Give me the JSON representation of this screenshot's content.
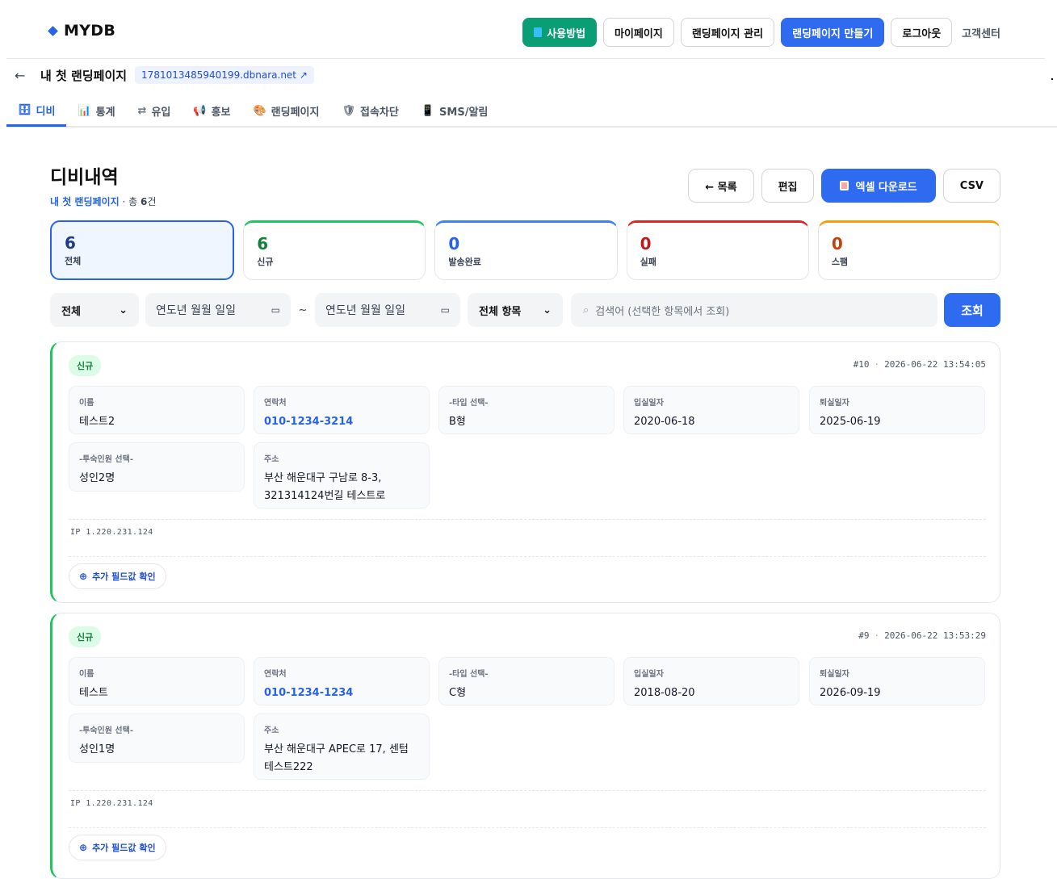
{
  "brand": "MYDB",
  "nav": {
    "guide": "사용방법",
    "mypage": "마이페이지",
    "manage": "랜딩페이지 관리",
    "create": "랜딩페이지 만들기",
    "logout": "로그아웃",
    "support": "고객센터"
  },
  "page": {
    "title": "내 첫 랜딩페이지",
    "url": "1781013485940199.dbnara.net"
  },
  "tabs": [
    {
      "label": "디비",
      "icon": "database-icon",
      "glyph": "🗄"
    },
    {
      "label": "통계",
      "icon": "chart-icon",
      "glyph": "📊"
    },
    {
      "label": "유입",
      "icon": "flow-icon",
      "glyph": "⇄"
    },
    {
      "label": "홍보",
      "icon": "megaphone-icon",
      "glyph": "📢"
    },
    {
      "label": "랜딩페이지",
      "icon": "palette-icon",
      "glyph": "🎨"
    },
    {
      "label": "접속차단",
      "icon": "shield-icon",
      "glyph": "🛡"
    },
    {
      "label": "SMS/알림",
      "icon": "phone-icon",
      "glyph": "📱"
    }
  ],
  "heading": {
    "title": "디비내역",
    "landing": "내 첫 랜딩페이지",
    "total_prefix": " · 총 ",
    "total": "6",
    "total_suffix": "건"
  },
  "actions": {
    "list": "← 목록",
    "edit": "편집",
    "excel": "엑셀 다운로드",
    "csv": "CSV"
  },
  "stats": [
    {
      "n": "6",
      "label": "전체",
      "color": "#1e3a8a"
    },
    {
      "n": "6",
      "label": "신규",
      "color": "#15803d"
    },
    {
      "n": "0",
      "label": "발송완료",
      "color": "#2563eb"
    },
    {
      "n": "0",
      "label": "실패",
      "color": "#b91c1c"
    },
    {
      "n": "0",
      "label": "스팸",
      "color": "#c2410c"
    }
  ],
  "stat_colors": [
    "#2563eb",
    "#22c55e",
    "#3b82f6",
    "#dc2626",
    "#f59e0b"
  ],
  "filters": {
    "status": "전체",
    "date_from": "연도년 월월 일일",
    "tilde": "~",
    "date_to": "연도년 월월 일일",
    "field": "전체 항목",
    "search_placeholder": "검색어 (선택한 항목에서 조회)",
    "search_btn": "조회"
  },
  "records": [
    {
      "badge": "신규",
      "id": "#10",
      "time": "2026-06-22 13:54:05",
      "fields": [
        {
          "label": "이름",
          "value": "테스트2",
          "link": false
        },
        {
          "label": "연락처",
          "value": "010-1234-3214",
          "link": true
        },
        {
          "label": "-타입 선택-",
          "value": "B형",
          "link": false
        },
        {
          "label": "입실일자",
          "value": "2020-06-18",
          "link": false
        },
        {
          "label": "퇴실일자",
          "value": "2025-06-19",
          "link": false
        },
        {
          "label": "-투숙인원 선택-",
          "value": "성인2명",
          "link": false
        },
        {
          "label": "주소",
          "value": "부산 해운대구 구남로 8-3,",
          "value2": "321314124번길 테스트로",
          "link": false
        }
      ],
      "ip": "IP 1.220.231.124",
      "more": "추가 필드값 확인"
    },
    {
      "badge": "신규",
      "id": "#9",
      "time": "2026-06-22 13:53:29",
      "fields": [
        {
          "label": "이름",
          "value": "테스트",
          "link": false
        },
        {
          "label": "연락처",
          "value": "010-1234-1234",
          "link": true
        },
        {
          "label": "-타입 선택-",
          "value": "C형",
          "link": false
        },
        {
          "label": "입실일자",
          "value": "2018-08-20",
          "link": false
        },
        {
          "label": "퇴실일자",
          "value": "2026-09-19",
          "link": false
        },
        {
          "label": "-투숙인원 선택-",
          "value": "성인1명",
          "link": false
        },
        {
          "label": "주소",
          "value": "부산 해운대구 APEC로 17, 센텀",
          "value2": "테스트222",
          "link": false
        }
      ],
      "ip": "IP 1.220.231.124",
      "more": "추가 필드값 확인"
    }
  ]
}
